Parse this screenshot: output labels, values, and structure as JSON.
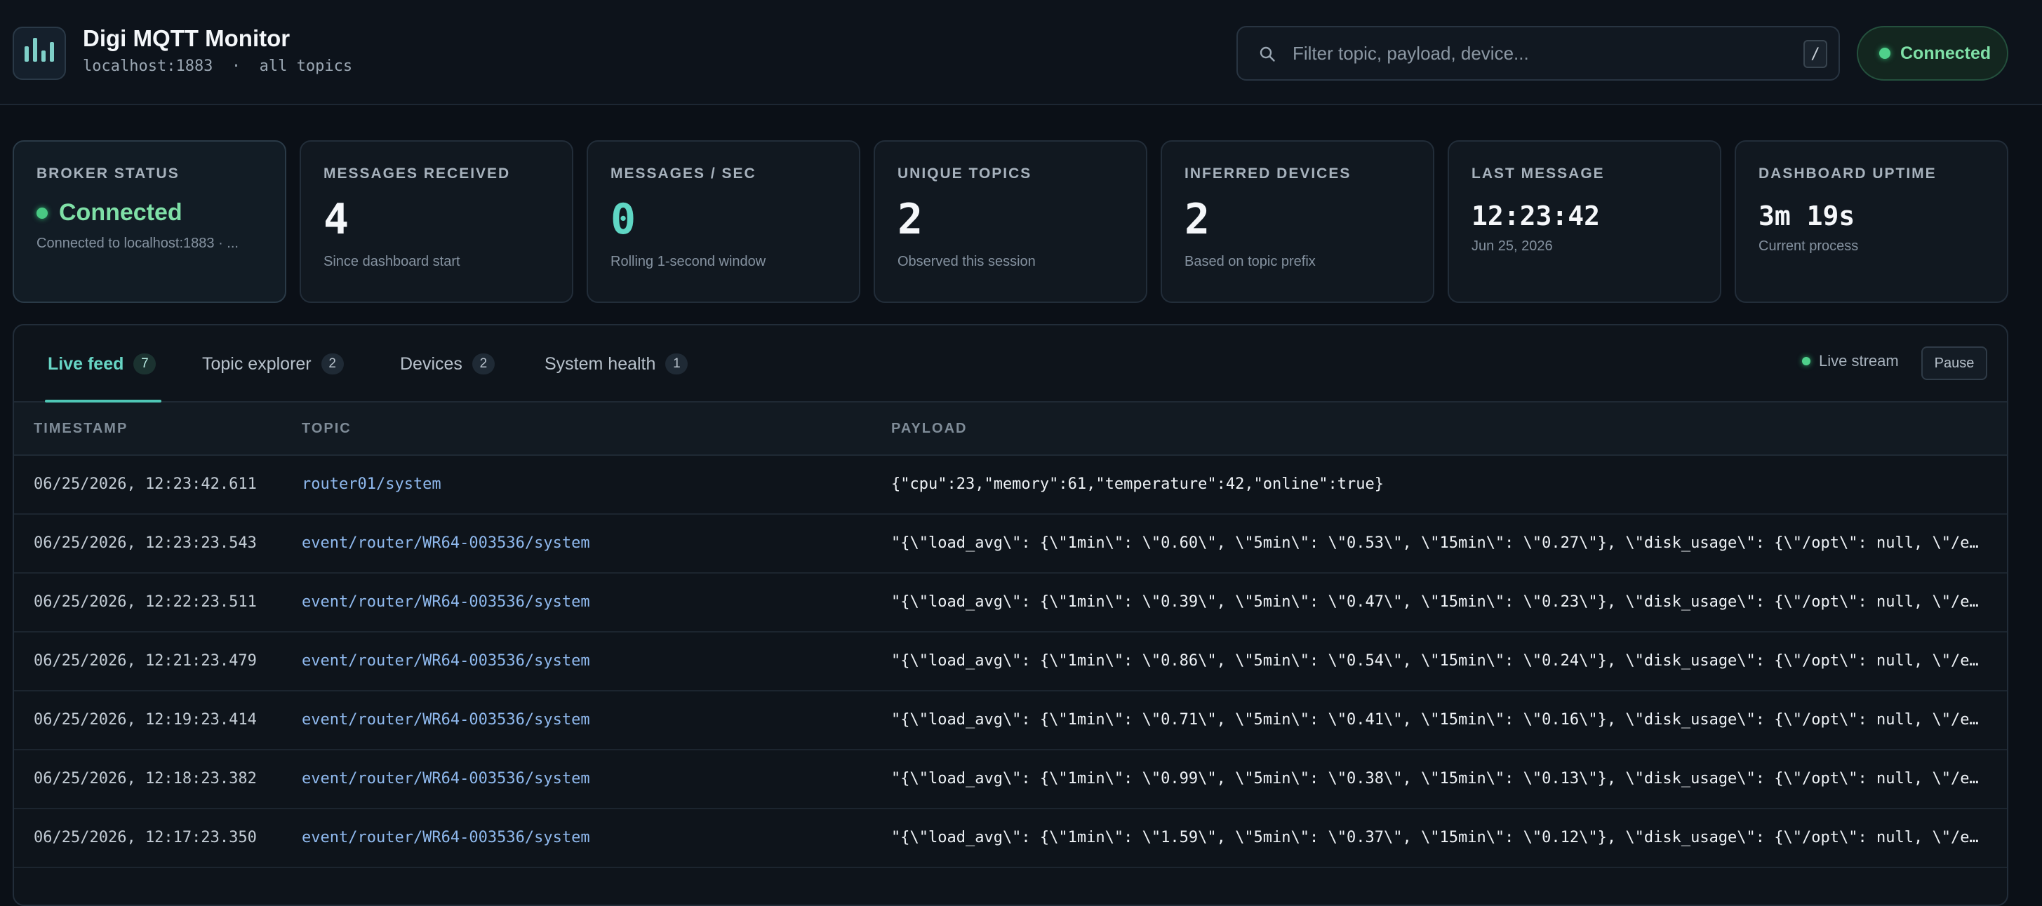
{
  "header": {
    "title": "Digi MQTT Monitor",
    "subtitle": "localhost:1883  ·  all topics",
    "search_placeholder": "Filter topic, payload, device...",
    "search_shortcut": "/",
    "connection_status": "Connected"
  },
  "stats": [
    {
      "label": "BROKER STATUS",
      "value": "Connected",
      "sub": "Connected to localhost:1883 · ..."
    },
    {
      "label": "MESSAGES RECEIVED",
      "value": "4",
      "sub": "Since dashboard start"
    },
    {
      "label": "MESSAGES / SEC",
      "value": "0",
      "sub": "Rolling 1-second window"
    },
    {
      "label": "UNIQUE TOPICS",
      "value": "2",
      "sub": "Observed this session"
    },
    {
      "label": "INFERRED DEVICES",
      "value": "2",
      "sub": "Based on topic prefix"
    },
    {
      "label": "LAST MESSAGE",
      "value": "12:23:42",
      "sub": "Jun 25, 2026"
    },
    {
      "label": "DASHBOARD UPTIME",
      "value": "3m 19s",
      "sub": "Current process"
    }
  ],
  "tabs": [
    {
      "label": "Live feed",
      "count": "7"
    },
    {
      "label": "Topic explorer",
      "count": "2"
    },
    {
      "label": "Devices",
      "count": "2"
    },
    {
      "label": "System health",
      "count": "1"
    }
  ],
  "stream": {
    "label": "Live stream",
    "pause_label": "Pause"
  },
  "table": {
    "columns": [
      "TIMESTAMP",
      "TOPIC",
      "PAYLOAD"
    ],
    "rows": [
      {
        "timestamp": "06/25/2026, 12:23:42.611",
        "topic": "router01/system",
        "payload": "{\"cpu\":23,\"memory\":61,\"temperature\":42,\"online\":true}"
      },
      {
        "timestamp": "06/25/2026, 12:23:23.543",
        "topic": "event/router/WR64-003536/system",
        "payload": "\"{\\\"load_avg\\\": {\\\"1min\\\": \\\"0.60\\\", \\\"5min\\\": \\\"0.53\\\", \\\"15min\\\": \\\"0.27\\\"}, \\\"disk_usage\\\": {\\\"/opt\\\": null, \\\"/e…"
      },
      {
        "timestamp": "06/25/2026, 12:22:23.511",
        "topic": "event/router/WR64-003536/system",
        "payload": "\"{\\\"load_avg\\\": {\\\"1min\\\": \\\"0.39\\\", \\\"5min\\\": \\\"0.47\\\", \\\"15min\\\": \\\"0.23\\\"}, \\\"disk_usage\\\": {\\\"/opt\\\": null, \\\"/e…"
      },
      {
        "timestamp": "06/25/2026, 12:21:23.479",
        "topic": "event/router/WR64-003536/system",
        "payload": "\"{\\\"load_avg\\\": {\\\"1min\\\": \\\"0.86\\\", \\\"5min\\\": \\\"0.54\\\", \\\"15min\\\": \\\"0.24\\\"}, \\\"disk_usage\\\": {\\\"/opt\\\": null, \\\"/e…"
      },
      {
        "timestamp": "06/25/2026, 12:19:23.414",
        "topic": "event/router/WR64-003536/system",
        "payload": "\"{\\\"load_avg\\\": {\\\"1min\\\": \\\"0.71\\\", \\\"5min\\\": \\\"0.41\\\", \\\"15min\\\": \\\"0.16\\\"}, \\\"disk_usage\\\": {\\\"/opt\\\": null, \\\"/e…"
      },
      {
        "timestamp": "06/25/2026, 12:18:23.382",
        "topic": "event/router/WR64-003536/system",
        "payload": "\"{\\\"load_avg\\\": {\\\"1min\\\": \\\"0.99\\\", \\\"5min\\\": \\\"0.38\\\", \\\"15min\\\": \\\"0.13\\\"}, \\\"disk_usage\\\": {\\\"/opt\\\": null, \\\"/e…"
      },
      {
        "timestamp": "06/25/2026, 12:17:23.350",
        "topic": "event/router/WR64-003536/system",
        "payload": "\"{\\\"load_avg\\\": {\\\"1min\\\": \\\"1.59\\\", \\\"5min\\\": \\\"0.37\\\", \\\"15min\\\": \\\"0.12\\\"}, \\\"disk_usage\\\": {\\\"/opt\\\": null, \\\"/e…"
      }
    ]
  },
  "colors": {
    "background": "#0b1017",
    "accent_teal": "#5fd6c4",
    "connected_green": "#4fd18b",
    "topic_blue": "#8fb9ee"
  },
  "icons": {
    "logo": "bar-chart-icon",
    "search": "search-icon",
    "status": "status-dot-icon"
  }
}
